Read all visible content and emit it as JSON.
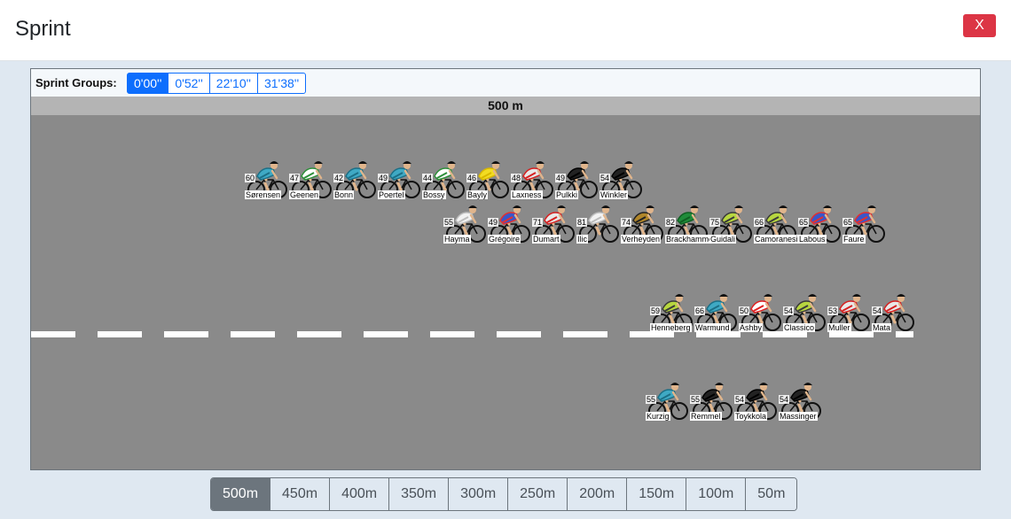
{
  "header": {
    "title": "Sprint",
    "close_label": "X"
  },
  "groups": {
    "label": "Sprint Groups:",
    "buttons": [
      "0'00''",
      "0'52''",
      "22'10''",
      "31'38''"
    ],
    "active": 0
  },
  "distance": {
    "label": "500 m"
  },
  "riders": [
    {
      "num": "60",
      "name": "Sørensen",
      "jersey": "#3fa9c4",
      "accent": "#1c6f86"
    },
    {
      "num": "47",
      "name": "Geenen",
      "jersey": "#ffffff",
      "accent": "#2f8f3a"
    },
    {
      "num": "42",
      "name": "Bonn",
      "jersey": "#3fa9c4",
      "accent": "#1c6f86"
    },
    {
      "num": "49",
      "name": "Poertel",
      "jersey": "#3fa9c4",
      "accent": "#1c6f86"
    },
    {
      "num": "44",
      "name": "Bossy",
      "jersey": "#ffffff",
      "accent": "#2f8f3a"
    },
    {
      "num": "46",
      "name": "Bayly",
      "jersey": "#f2dc22",
      "accent": "#d9b800"
    },
    {
      "num": "48",
      "name": "Laxness",
      "jersey": "#e8e8e8",
      "accent": "#d62020"
    },
    {
      "num": "49",
      "name": "Pulkki",
      "jersey": "#222222",
      "accent": "#000000"
    },
    {
      "num": "54",
      "name": "Winkler",
      "jersey": "#222222",
      "accent": "#000000"
    },
    {
      "num": "55",
      "name": "Hayma",
      "jersey": "#f2f2f2",
      "accent": "#bdbdbd"
    },
    {
      "num": "49",
      "name": "Grégoire",
      "jersey": "#3b56c9",
      "accent": "#e33030"
    },
    {
      "num": "71",
      "name": "Dumart",
      "jersey": "#e8e8e8",
      "accent": "#d62020"
    },
    {
      "num": "81",
      "name": "Ilic",
      "jersey": "#f2f2f2",
      "accent": "#bdbdbd"
    },
    {
      "num": "74",
      "name": "Verheyden",
      "jersey": "#b0862a",
      "accent": "#222222"
    },
    {
      "num": "82",
      "name": "Brackhammer",
      "jersey": "#1f8c3a",
      "accent": "#0f5f22"
    },
    {
      "num": "75",
      "name": "Guidali",
      "jersey": "#b7d63f",
      "accent": "#3a3a3a"
    },
    {
      "num": "66",
      "name": "Camoranesi",
      "jersey": "#b7d63f",
      "accent": "#3a3a3a"
    },
    {
      "num": "65",
      "name": "Labous",
      "jersey": "#3b56c9",
      "accent": "#e33030"
    },
    {
      "num": "65",
      "name": "Faure",
      "jersey": "#3b56c9",
      "accent": "#e33030"
    },
    {
      "num": "59",
      "name": "Henneberg",
      "jersey": "#b7d63f",
      "accent": "#3a3a3a"
    },
    {
      "num": "66",
      "name": "Warmund",
      "jersey": "#3fa9c4",
      "accent": "#1c6f86"
    },
    {
      "num": "50",
      "name": "Ashby",
      "jersey": "#ffffff",
      "accent": "#e02020"
    },
    {
      "num": "54",
      "name": "Classico",
      "jersey": "#b7d63f",
      "accent": "#3a3a3a"
    },
    {
      "num": "53",
      "name": "Muller",
      "jersey": "#e8e8e8",
      "accent": "#d62020"
    },
    {
      "num": "54",
      "name": "Mata",
      "jersey": "#e8e8e8",
      "accent": "#d62020"
    },
    {
      "num": "55",
      "name": "Kurzig",
      "jersey": "#3fa9c4",
      "accent": "#1c6f86"
    },
    {
      "num": "55",
      "name": "Remmel",
      "jersey": "#222222",
      "accent": "#000000"
    },
    {
      "num": "54",
      "name": "Toykkola",
      "jersey": "#222222",
      "accent": "#000000"
    },
    {
      "num": "54",
      "name": "Massinger",
      "jersey": "#222222",
      "accent": "#000000"
    }
  ],
  "distance_buttons": [
    "500m",
    "450m",
    "400m",
    "350m",
    "300m",
    "250m",
    "200m",
    "150m",
    "100m",
    "50m"
  ],
  "distance_active": 0
}
